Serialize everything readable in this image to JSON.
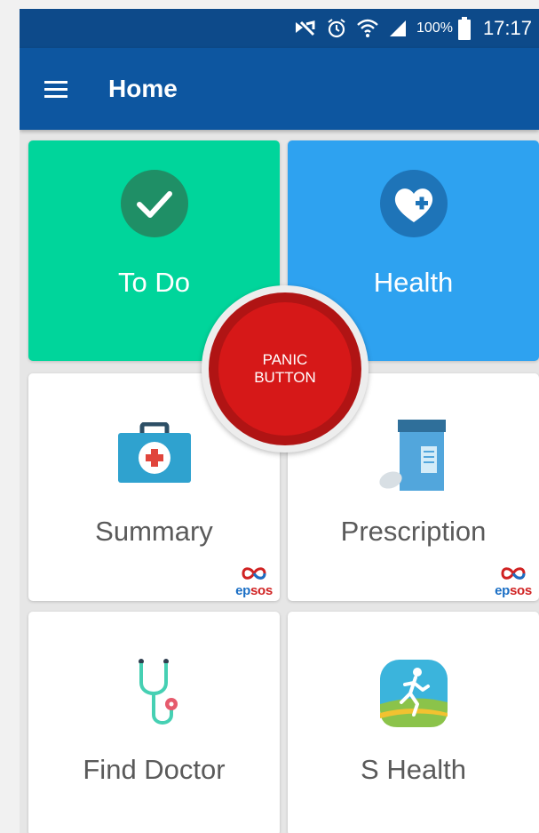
{
  "status_bar": {
    "battery_percent": "100%",
    "time": "17:17",
    "icons": [
      "mute-icon",
      "alarm-icon",
      "wifi-icon",
      "signal-icon",
      "battery-icon"
    ]
  },
  "app_bar": {
    "menu_icon": "hamburger-menu-icon",
    "title": "Home"
  },
  "tiles": [
    {
      "id": "todo",
      "label": "To Do",
      "icon": "check-icon",
      "color": "#00d59b"
    },
    {
      "id": "health",
      "label": "Health",
      "icon": "heart-plus-icon",
      "color": "#2ea2f0"
    },
    {
      "id": "summary",
      "label": "Summary",
      "icon": "medical-kit-icon",
      "badge": "epsos"
    },
    {
      "id": "prescription",
      "label": "Prescription",
      "icon": "pill-bottle-icon",
      "badge": "epsos"
    },
    {
      "id": "find_doctor",
      "label": "Find Doctor",
      "icon": "stethoscope-icon"
    },
    {
      "id": "s_health",
      "label": "S Health",
      "icon": "runner-app-icon"
    }
  ],
  "panic_button": {
    "line1": "PANIC",
    "line2": "BUTTON",
    "color": "#d61818"
  },
  "colors": {
    "status_bar": "#0d4a8a",
    "app_bar": "#0d56a0",
    "background": "#e6e6e6"
  }
}
